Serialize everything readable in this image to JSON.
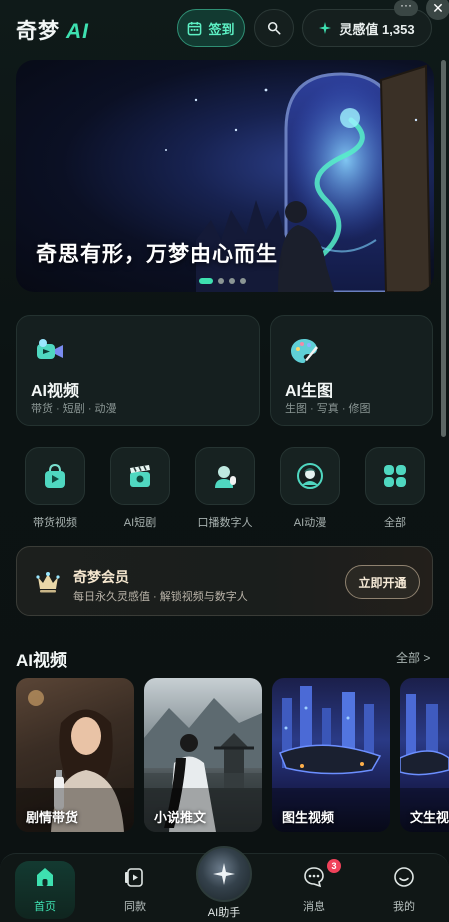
{
  "header": {
    "logo_text": "奇梦",
    "logo_ai": "AI",
    "checkin_label": "签到",
    "points_label": "灵感值 1,353",
    "more_label": "···",
    "close_label": "✕"
  },
  "banner": {
    "title": "奇思有形，万梦由心而生",
    "page_count": 4,
    "active_page": 1
  },
  "features": [
    {
      "title": "AI视频",
      "subtitle": "带货 · 短剧 · 动漫",
      "icon": "video-camera-icon"
    },
    {
      "title": "AI生图",
      "subtitle": "生图 · 写真 · 修图",
      "icon": "palette-icon"
    }
  ],
  "tools": [
    {
      "label": "带货视频",
      "icon": "shopping-bag-icon"
    },
    {
      "label": "AI短剧",
      "icon": "clapperboard-icon"
    },
    {
      "label": "口播数字人",
      "icon": "digital-human-icon"
    },
    {
      "label": "AI动漫",
      "icon": "anime-avatar-icon"
    },
    {
      "label": "全部",
      "icon": "grid-icon"
    }
  ],
  "membership": {
    "title": "奇梦会员",
    "subtitle": "每日永久灵感值 · 解锁视频与数字人",
    "button_label": "立即开通",
    "icon": "crown-icon"
  },
  "video_section": {
    "title": "AI视频",
    "more_label": "全部 >",
    "cards": [
      {
        "label": "剧情带货"
      },
      {
        "label": "小说推文"
      },
      {
        "label": "图生视频"
      },
      {
        "label": "文生视频"
      }
    ]
  },
  "bottom_nav": {
    "items": [
      {
        "label": "首页",
        "icon": "home-icon"
      },
      {
        "label": "同款",
        "icon": "template-icon"
      },
      {
        "label": "AI助手",
        "icon": "sparkle-icon"
      },
      {
        "label": "消息",
        "icon": "message-icon"
      },
      {
        "label": "我的",
        "icon": "profile-icon"
      }
    ],
    "message_badge": "3",
    "active_index": 0
  },
  "colors": {
    "accent": "#3ee0b0",
    "background": "#0d1414",
    "badge": "#f0425a",
    "member_gold": "#f5e7cf"
  }
}
